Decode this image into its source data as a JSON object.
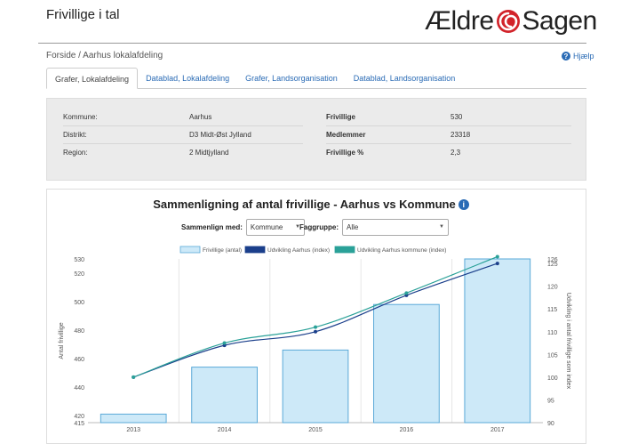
{
  "app": {
    "title": "Frivillige i tal",
    "logo_text_left": "Ældre",
    "logo_text_right": "Sagen"
  },
  "breadcrumb": {
    "home": "Forside",
    "sep": " / ",
    "current": "Aarhus lokalafdeling"
  },
  "help": {
    "label": "Hjælp"
  },
  "tabs": [
    {
      "label": "Grafer, Lokalafdeling",
      "active": true
    },
    {
      "label": "Datablad, Lokalafdeling",
      "active": false
    },
    {
      "label": "Grafer, Landsorganisation",
      "active": false
    },
    {
      "label": "Datablad, Landsorganisation",
      "active": false
    }
  ],
  "info": {
    "left": [
      {
        "label": "Kommune:",
        "value": "Aarhus"
      },
      {
        "label": "Distrikt:",
        "value": "D3 Midt-Øst Jylland"
      },
      {
        "label": "Region:",
        "value": "2 Midtjylland"
      }
    ],
    "right": [
      {
        "label": "Frivillige",
        "value": "530"
      },
      {
        "label": "Medlemmer",
        "value": "23318"
      },
      {
        "label": "Frivillige %",
        "value": "2,3"
      }
    ]
  },
  "chart_header": {
    "title": "Sammenligning af antal frivillige - Aarhus vs Kommune",
    "compare_label": "Sammenlign med:",
    "compare_value": "Kommune",
    "group_label": "Faggruppe:",
    "group_value": "Alle"
  },
  "colors": {
    "bar_fill": "#cde9f8",
    "bar_stroke": "#5aa9d8",
    "line_aarhus": "#1b3f8b",
    "line_kommune": "#2aa198",
    "link": "#2a6bb5"
  },
  "chart_data": {
    "type": "bar+line",
    "categories": [
      "2013",
      "2014",
      "2015",
      "2016",
      "2017"
    ],
    "legend": [
      "Frivillige (antal)",
      "Udvikling Aarhus (index)",
      "Udvikling Aarhus kommune (index)"
    ],
    "series": [
      {
        "name": "Frivillige (antal)",
        "type": "bar",
        "axis": "left",
        "values": [
          421,
          454,
          466,
          498,
          530
        ]
      },
      {
        "name": "Udvikling Aarhus (index)",
        "type": "line",
        "axis": "right",
        "values": [
          100,
          107,
          110,
          118,
          125
        ]
      },
      {
        "name": "Udvikling Aarhus kommune (index)",
        "type": "line",
        "axis": "right",
        "values": [
          100,
          107.5,
          111,
          118.5,
          126.5
        ]
      }
    ],
    "ylabel": "Antal frivillige",
    "y2label": "Udvikling i antal frivillige som index",
    "left_ticks": [
      415,
      420,
      440,
      460,
      480,
      500,
      520,
      530
    ],
    "right_ticks": [
      90,
      95,
      100,
      105,
      110,
      115,
      120,
      125,
      126
    ],
    "ylim": [
      415,
      530
    ],
    "y2lim": [
      90,
      126
    ]
  }
}
